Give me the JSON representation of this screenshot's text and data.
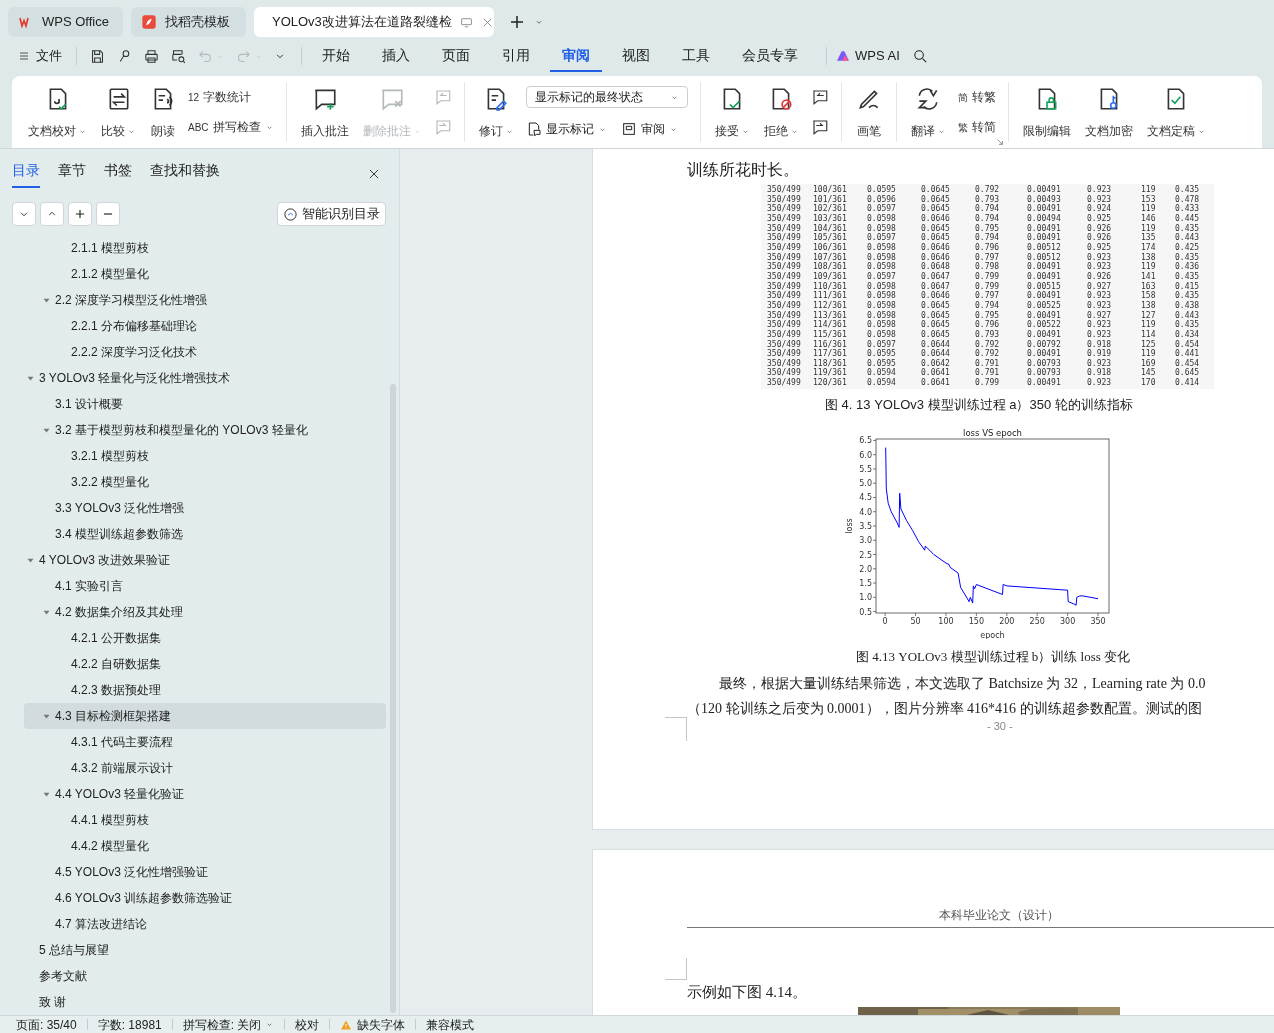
{
  "app_tabs": [
    {
      "label": "WPS Office",
      "selected": false
    },
    {
      "label": "找稻壳模板",
      "selected": false
    },
    {
      "label": "YOLOv3改进算法在道路裂缝检",
      "selected": true
    }
  ],
  "file_menu": "文件",
  "quick_access": [
    {
      "disabled": false
    },
    {
      "disabled": false
    },
    {
      "disabled": false
    },
    {
      "disabled": false
    },
    {
      "disabled": true
    },
    {
      "disabled": true
    }
  ],
  "menu_tabs": [
    {
      "label": "开始",
      "selected": false
    },
    {
      "label": "插入",
      "selected": false
    },
    {
      "label": "页面",
      "selected": false
    },
    {
      "label": "引用",
      "selected": false
    },
    {
      "label": "审阅",
      "selected": true
    },
    {
      "label": "视图",
      "selected": false
    },
    {
      "label": "工具",
      "selected": false
    },
    {
      "label": "会员专享",
      "selected": false
    }
  ],
  "ai_label": "WPS AI",
  "ribbon": [
    {
      "launcher": false,
      "items": [
        {
          "kind": "big",
          "label": "文档校对",
          "dropdown": true,
          "disabled": false
        },
        {
          "kind": "big",
          "label": "比较",
          "dropdown": true,
          "disabled": false
        },
        {
          "kind": "big",
          "label": "朗读",
          "dropdown": false,
          "disabled": false
        },
        {
          "kind": "stack",
          "items": [
            {
              "glyph": "12",
              "label": "字数统计",
              "dropdown": false
            },
            {
              "glyph": "ABC",
              "label": "拼写检查",
              "dropdown": true
            }
          ]
        }
      ]
    },
    {
      "launcher": false,
      "items": [
        {
          "kind": "big",
          "label": "插入批注",
          "dropdown": false,
          "disabled": false
        },
        {
          "kind": "big",
          "label": "删除批注",
          "dropdown": true,
          "disabled": true
        },
        {
          "kind": "icon-pair",
          "disabled": true
        }
      ]
    },
    {
      "launcher": false,
      "items": [
        {
          "kind": "big",
          "label": "修订",
          "dropdown": true,
          "disabled": false
        },
        {
          "kind": "select-stack",
          "value": "显示标记的最终状态",
          "items": [
            {
              "label": "显示标记",
              "dropdown": true
            },
            {
              "label": "审阅",
              "dropdown": true
            }
          ]
        }
      ]
    },
    {
      "launcher": false,
      "items": [
        {
          "kind": "big",
          "label": "接受",
          "dropdown": true,
          "disabled": false
        },
        {
          "kind": "big",
          "label": "拒绝",
          "dropdown": true,
          "disabled": false
        },
        {
          "kind": "icon-pair",
          "disabled": false
        }
      ]
    },
    {
      "launcher": false,
      "items": [
        {
          "kind": "big",
          "label": "画笔",
          "dropdown": false,
          "disabled": false
        }
      ]
    },
    {
      "launcher": true,
      "items": [
        {
          "kind": "big",
          "label": "翻译",
          "dropdown": true,
          "disabled": false
        },
        {
          "kind": "stack",
          "items": [
            {
              "glyph": "简",
              "label": "转繁",
              "dropdown": false
            },
            {
              "glyph": "繁",
              "label": "转简",
              "dropdown": false
            }
          ]
        }
      ]
    },
    {
      "launcher": false,
      "items": [
        {
          "kind": "big",
          "label": "限制编辑",
          "dropdown": false,
          "disabled": false
        },
        {
          "kind": "big",
          "label": "文档加密",
          "dropdown": false,
          "disabled": false
        },
        {
          "kind": "big",
          "label": "文档定稿",
          "dropdown": true,
          "disabled": false
        }
      ]
    }
  ],
  "sidebar": {
    "tabs": [
      {
        "label": "目录",
        "selected": true
      },
      {
        "label": "章节",
        "selected": false
      },
      {
        "label": "书签",
        "selected": false
      },
      {
        "label": "查找和替换",
        "selected": false
      }
    ],
    "smart_button": "智能识别目录",
    "items": [
      {
        "children": [
          {
            "children": [
              {
                "label": "2.1.1 模型剪枝",
                "selected": false
              },
              {
                "label": "2.1.2 模型量化",
                "selected": false
              }
            ]
          },
          {
            "label": "2.2 深度学习模型泛化性增强",
            "selected": false,
            "expanded": true,
            "children": [
              {
                "label": "2.2.1 分布偏移基础理论",
                "selected": false
              },
              {
                "label": "2.2.2 深度学习泛化技术",
                "selected": false
              }
            ]
          }
        ]
      },
      {
        "label": "3 YOLOv3 轻量化与泛化性增强技术",
        "selected": false,
        "expanded": true,
        "children": [
          {
            "label": "3.1 设计概要",
            "selected": false
          },
          {
            "label": "3.2 基于模型剪枝和模型量化的 YOLOv3 轻量化",
            "selected": false,
            "expanded": true,
            "children": [
              {
                "label": "3.2.1 模型剪枝",
                "selected": false
              },
              {
                "label": "3.2.2 模型量化",
                "selected": false
              }
            ]
          },
          {
            "label": "3.3 YOLOv3 泛化性增强",
            "selected": false
          },
          {
            "label": "3.4 模型训练超参数筛选",
            "selected": false
          }
        ]
      },
      {
        "label": "4 YOLOv3 改进效果验证",
        "selected": false,
        "expanded": true,
        "children": [
          {
            "label": "4.1 实验引言",
            "selected": false
          },
          {
            "label": "4.2 数据集介绍及其处理",
            "selected": false,
            "expanded": true,
            "children": [
              {
                "label": "4.2.1 公开数据集",
                "selected": false
              },
              {
                "label": "4.2.2 自研数据集",
                "selected": false
              },
              {
                "label": "4.2.3 数据预处理",
                "selected": false
              }
            ]
          },
          {
            "label": "4.3 目标检测框架搭建",
            "selected": true,
            "expanded": true,
            "children": [
              {
                "label": "4.3.1 代码主要流程",
                "selected": false
              },
              {
                "label": "4.3.2 前端展示设计",
                "selected": false
              }
            ]
          },
          {
            "label": "4.4 YOLOv3 轻量化验证",
            "selected": false,
            "expanded": true,
            "children": [
              {
                "label": "4.4.1 模型剪枝",
                "selected": false
              },
              {
                "label": "4.4.2 模型量化",
                "selected": false
              }
            ]
          },
          {
            "label": "4.5 YOLOv3 泛化性增强验证",
            "selected": false
          },
          {
            "label": "4.6 YOLOv3 训练超参数筛选验证",
            "selected": false
          },
          {
            "label": "4.7 算法改进结论",
            "selected": false
          }
        ]
      },
      {
        "label": "5 总结与展望",
        "selected": false
      },
      {
        "label": "参考文献",
        "selected": false
      },
      {
        "label": "致 谢",
        "selected": false
      }
    ]
  },
  "page1": {
    "top_line": "训练所花时长。",
    "table_rows": [
      [
        "350/499",
        "100/361",
        "0.0595",
        "0.0645",
        "0.792",
        "0.00491",
        "0.923",
        "119",
        "0.435"
      ],
      [
        "350/499",
        "101/361",
        "0.0596",
        "0.0645",
        "0.793",
        "0.00493",
        "0.923",
        "153",
        "0.478"
      ],
      [
        "350/499",
        "102/361",
        "0.0597",
        "0.0645",
        "0.794",
        "0.00491",
        "0.924",
        "119",
        "0.433"
      ],
      [
        "350/499",
        "103/361",
        "0.0598",
        "0.0646",
        "0.794",
        "0.00494",
        "0.925",
        "146",
        "0.445"
      ],
      [
        "350/499",
        "104/361",
        "0.0598",
        "0.0645",
        "0.795",
        "0.00491",
        "0.926",
        "119",
        "0.435"
      ],
      [
        "350/499",
        "105/361",
        "0.0597",
        "0.0645",
        "0.794",
        "0.00491",
        "0.926",
        "135",
        "0.443"
      ],
      [
        "350/499",
        "106/361",
        "0.0598",
        "0.0646",
        "0.796",
        "0.00512",
        "0.925",
        "174",
        "0.425"
      ],
      [
        "350/499",
        "107/361",
        "0.0598",
        "0.0646",
        "0.797",
        "0.00512",
        "0.923",
        "138",
        "0.435"
      ],
      [
        "350/499",
        "108/361",
        "0.0598",
        "0.0648",
        "0.798",
        "0.00491",
        "0.923",
        "119",
        "0.436"
      ],
      [
        "350/499",
        "109/361",
        "0.0597",
        "0.0647",
        "0.799",
        "0.00491",
        "0.926",
        "141",
        "0.435"
      ],
      [
        "350/499",
        "110/361",
        "0.0598",
        "0.0647",
        "0.799",
        "0.00515",
        "0.927",
        "163",
        "0.415"
      ],
      [
        "350/499",
        "111/361",
        "0.0598",
        "0.0646",
        "0.797",
        "0.00491",
        "0.923",
        "158",
        "0.435"
      ],
      [
        "350/499",
        "112/361",
        "0.0598",
        "0.0645",
        "0.794",
        "0.00525",
        "0.923",
        "138",
        "0.438"
      ],
      [
        "350/499",
        "113/361",
        "0.0598",
        "0.0645",
        "0.795",
        "0.00491",
        "0.927",
        "127",
        "0.443"
      ],
      [
        "350/499",
        "114/361",
        "0.0598",
        "0.0645",
        "0.796",
        "0.00522",
        "0.923",
        "119",
        "0.435"
      ],
      [
        "350/499",
        "115/361",
        "0.0598",
        "0.0645",
        "0.793",
        "0.00491",
        "0.923",
        "114",
        "0.434"
      ],
      [
        "350/499",
        "116/361",
        "0.0597",
        "0.0644",
        "0.792",
        "0.00792",
        "0.918",
        "125",
        "0.454"
      ],
      [
        "350/499",
        "117/361",
        "0.0595",
        "0.0644",
        "0.792",
        "0.00491",
        "0.919",
        "119",
        "0.441"
      ],
      [
        "350/499",
        "118/361",
        "0.0595",
        "0.0642",
        "0.791",
        "0.00793",
        "0.923",
        "169",
        "0.454"
      ],
      [
        "350/499",
        "119/361",
        "0.0594",
        "0.0641",
        "0.791",
        "0.00793",
        "0.918",
        "145",
        "0.645"
      ],
      [
        "350/499",
        "120/361",
        "0.0594",
        "0.0641",
        "0.799",
        "0.00491",
        "0.923",
        "170",
        "0.414"
      ]
    ],
    "caption_a": "图 4. 13  YOLOv3 模型训练过程 a）350 轮的训练指标",
    "chart_data": {
      "type": "line",
      "title": "loss VS epoch",
      "xlabel": "epoch",
      "ylabel": "loss",
      "x": [
        1,
        2,
        5,
        10,
        20,
        23,
        24,
        26,
        35,
        45,
        55,
        65,
        66,
        80,
        100,
        105,
        107,
        120,
        124,
        138,
        140,
        144,
        145,
        147,
        150,
        193,
        194,
        200,
        300,
        301,
        312,
        314,
        315,
        320,
        325,
        350
      ],
      "series": [
        {
          "color": "#0000ff",
          "values": [
            6.25,
            4.8,
            4.3,
            4.0,
            3.6,
            3.45,
            4.65,
            4.1,
            3.7,
            3.35,
            2.95,
            2.65,
            2.8,
            2.5,
            2.2,
            2.15,
            2.05,
            1.85,
            1.35,
            0.85,
            1.0,
            0.8,
            1.4,
            1.3,
            1.45,
            1.1,
            1.45,
            1.4,
            1.25,
            0.85,
            0.75,
            0.72,
            1.0,
            1.05,
            1.05,
            0.95
          ]
        }
      ],
      "xlim": [
        -15,
        368
      ],
      "ylim": [
        0.45,
        6.55
      ],
      "xticks": [
        0,
        50,
        100,
        150,
        200,
        250,
        300,
        350
      ],
      "yticks": [
        {
          "value": 0.5,
          "label": "0.5"
        },
        {
          "value": 1,
          "label": "1.0"
        },
        {
          "value": 1.5,
          "label": "1.5"
        },
        {
          "value": 2,
          "label": "2.0"
        },
        {
          "value": 2.5,
          "label": "2.5"
        },
        {
          "value": 3,
          "label": "3.0"
        },
        {
          "value": 3.5,
          "label": "3.5"
        },
        {
          "value": 4,
          "label": "4.0"
        },
        {
          "value": 4.5,
          "label": "4.5"
        },
        {
          "value": 5,
          "label": "5.0"
        },
        {
          "value": 5.5,
          "label": "5.5"
        },
        {
          "value": 6,
          "label": "6.0"
        },
        {
          "value": 6.5,
          "label": "6.5"
        }
      ]
    },
    "caption_b": "图 4.13 YOLOv3 模型训练过程 b）训练 loss 变化",
    "paragraph_lines": [
      "最终，根据大量训练结果筛选，本文选取了 Batchsize 为 32，Learning rate 为 0.0",
      "（120 轮训练之后变为 0.0001），图片分辨率 416*416 的训练超参数配置。测试的图"
    ],
    "page_number": "- 30 -"
  },
  "page2": {
    "header": "本科毕业论文（设计）",
    "text": "示例如下图 4.14。"
  },
  "status_bar": {
    "page": "页面: 35/40",
    "words": "字数: 18981",
    "spellcheck": "拼写检查: 关闭",
    "proofread": "校对",
    "missing_fonts": "缺失字体",
    "compat": "兼容模式"
  }
}
